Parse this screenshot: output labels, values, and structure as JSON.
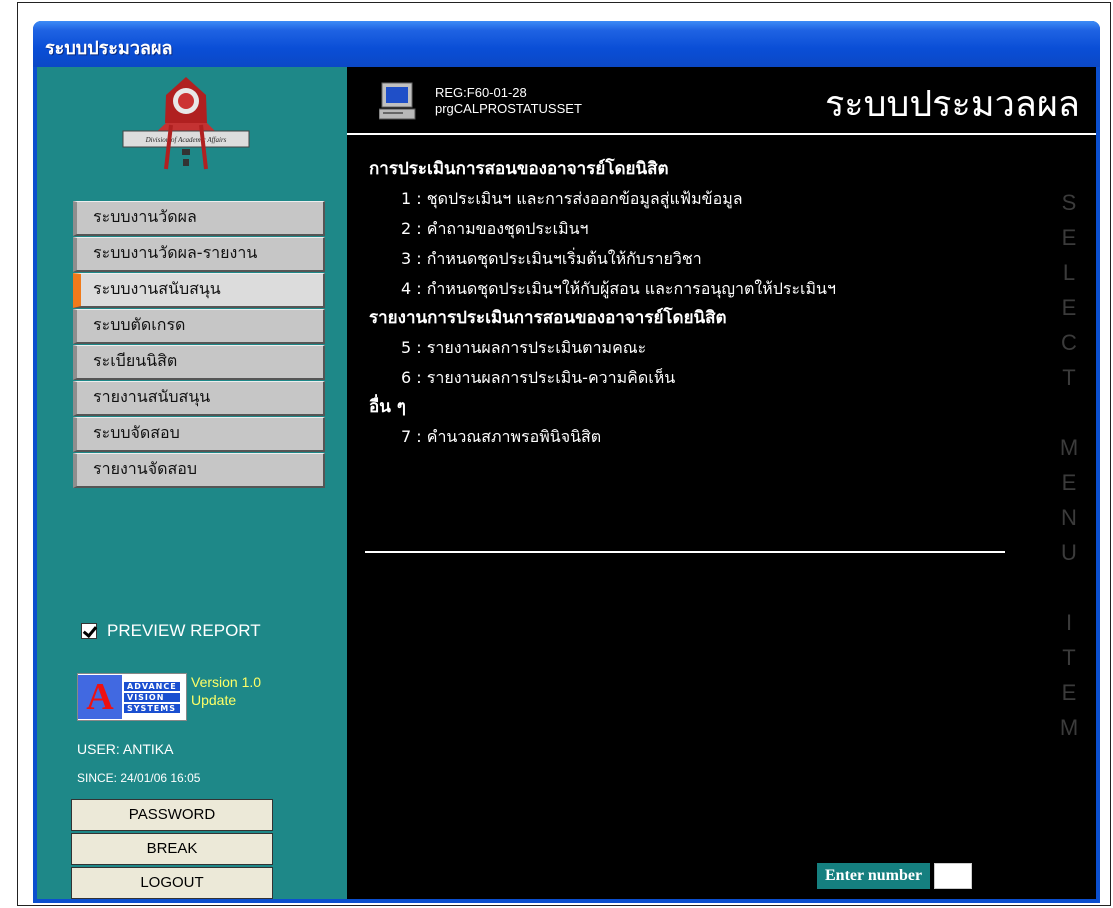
{
  "window": {
    "title": "ระบบประมวลผล"
  },
  "logo": {
    "caption": "Division of Academic Affairs"
  },
  "menu": {
    "items": [
      {
        "label": "ระบบงานวัดผล"
      },
      {
        "label": "ระบบงานวัดผล-รายงาน"
      },
      {
        "label": "ระบบงานสนับสนุน",
        "active": true
      },
      {
        "label": "ระบบตัดเกรด"
      },
      {
        "label": "ระเบียนนิสิต"
      },
      {
        "label": "รายงานสนับสนุน"
      },
      {
        "label": "ระบบจัดสอบ"
      },
      {
        "label": "รายงานจัดสอบ"
      }
    ]
  },
  "preview": {
    "label": "PREVIEW REPORT",
    "checked": true
  },
  "avs": {
    "line1": "ADVANCE",
    "line2": "VISION",
    "line3": "SYSTEMS",
    "version": "Version 1.0",
    "update": "Update"
  },
  "user": {
    "name": "USER: ANTIKA",
    "since": "SINCE: 24/01/06 16:05"
  },
  "buttons": {
    "password": "PASSWORD",
    "break": "BREAK",
    "logout": "LOGOUT"
  },
  "header": {
    "reg": "REG:F60-01-28",
    "prg": "prgCALPROSTATUSSET",
    "title": "ระบบประมวลผล"
  },
  "content": {
    "section1": "การประเมินการสอนของอาจารย์โดยนิสิต",
    "items1": [
      "1 : ชุดประเมินฯ และการส่งออกข้อมูลสู่แฟ้มข้อมูล",
      "2 : คำถามของชุดประเมินฯ",
      "3 : กำหนดชุดประเมินฯเริ่มต้นให้กับรายวิชา",
      "4 : กำหนดชุดประเมินฯให้กับผู้สอน และการอนุญาตให้ประเมินฯ"
    ],
    "section2": "รายงานการประเมินการสอนของอาจารย์โดยนิสิต",
    "items2": [
      "5 : รายงานผลการประเมินตามคณะ",
      "6 : รายงานผลการประเมิน-ความคิดเห็น"
    ],
    "section3": "อื่น ๆ",
    "items3": [
      "7 : คำนวณสภาพรอพินิจนิสิต"
    ]
  },
  "vertical_text": [
    "S",
    "E",
    "L",
    "E",
    "C",
    "T",
    "",
    "M",
    "E",
    "N",
    "U",
    "",
    "I",
    "T",
    "E",
    "M"
  ],
  "enter": {
    "label": "Enter number",
    "value": ""
  },
  "colors": {
    "sidebar": "#1e8888",
    "main": "#000000",
    "titlebar": "#0b4fcf",
    "active_marker": "#f07a1a"
  }
}
